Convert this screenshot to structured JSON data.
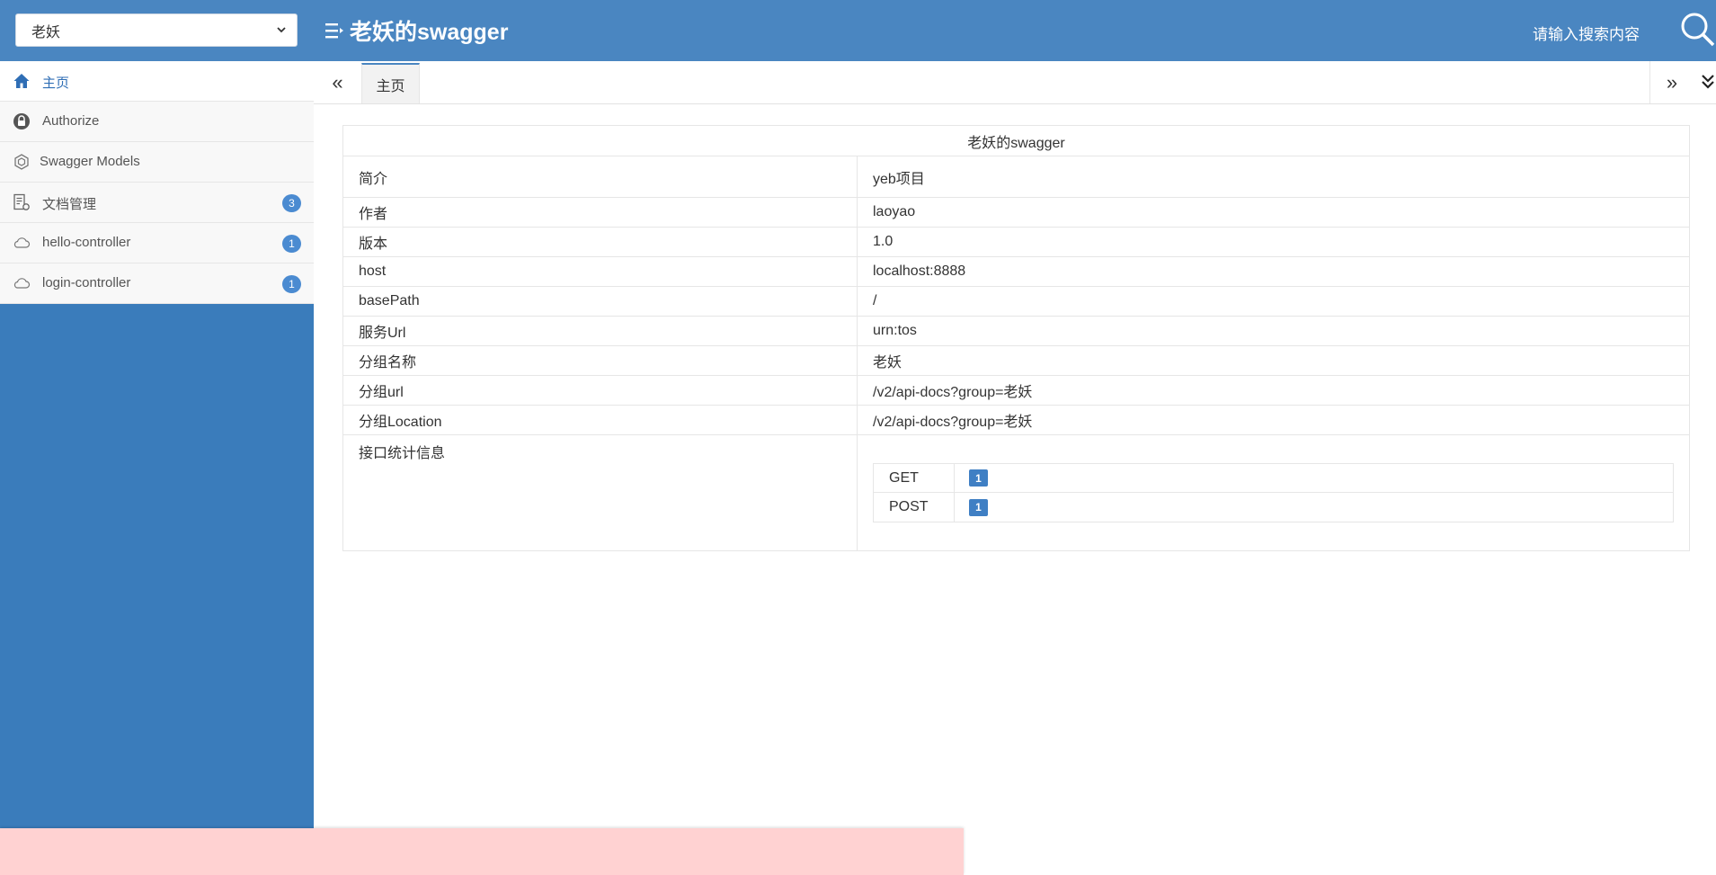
{
  "header": {
    "group_select": "老妖",
    "title": "老妖的swagger",
    "search_placeholder": "请输入搜索内容",
    "colors": {
      "bar": "#4a86c1",
      "sidebar": "#3a7cbb",
      "accent": "#2f6eb5"
    }
  },
  "sidebar": {
    "items": [
      {
        "label": "主页",
        "icon": "home-icon",
        "active": true
      },
      {
        "label": "Authorize",
        "icon": "lock-icon"
      },
      {
        "label": "Swagger Models",
        "icon": "models-icon"
      },
      {
        "label": "文档管理",
        "icon": "doc-settings-icon",
        "badge": "3"
      },
      {
        "label": "hello-controller",
        "icon": "cloud-icon",
        "badge": "1"
      },
      {
        "label": "login-controller",
        "icon": "cloud-icon",
        "badge": "1"
      }
    ]
  },
  "tabs": {
    "items": [
      {
        "label": "主页"
      }
    ]
  },
  "info": {
    "title": "老妖的swagger",
    "rows": [
      {
        "k": "简介",
        "v": "yeb项目"
      },
      {
        "k": "作者",
        "v": "laoyao"
      },
      {
        "k": "版本",
        "v": "1.0"
      },
      {
        "k": "host",
        "v": "localhost:8888"
      },
      {
        "k": "basePath",
        "v": "/"
      },
      {
        "k": "服务Url",
        "v": "urn:tos"
      },
      {
        "k": "分组名称",
        "v": "老妖"
      },
      {
        "k": "分组url",
        "v": "/v2/api-docs?group=老妖"
      },
      {
        "k": "分组Location",
        "v": "/v2/api-docs?group=老妖"
      }
    ],
    "stats_label": "接口统计信息",
    "stats": [
      {
        "method": "GET",
        "count": "1"
      },
      {
        "method": "POST",
        "count": "1"
      }
    ]
  }
}
